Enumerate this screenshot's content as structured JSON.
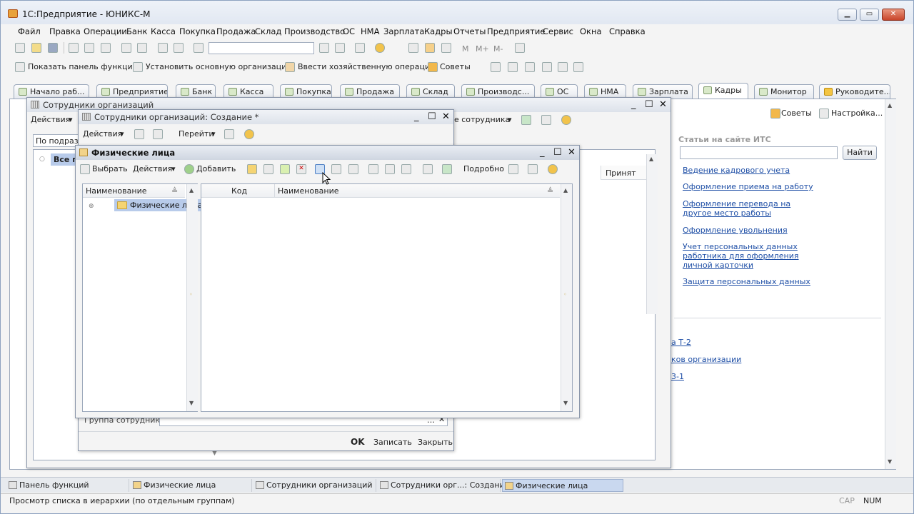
{
  "app": {
    "title": "1С:Предприятие - ЮНИКС-М"
  },
  "menu": [
    "Файл",
    "Правка",
    "Операции",
    "Банк",
    "Касса",
    "Покупка",
    "Продажа",
    "Склад",
    "Производство",
    "ОС",
    "НМА",
    "Зарплата",
    "Кадры",
    "Отчеты",
    "Предприятие",
    "Сервис",
    "Окна",
    "Справка"
  ],
  "toolbar2": {
    "show_panel": "Показать панель функций",
    "set_org": "Установить основную организацию",
    "enter_op": "Ввести хозяйственную операцию",
    "tips": "Советы"
  },
  "tabs": [
    "Начало раб...",
    "Предприятие",
    "Банк",
    "Касса",
    "Покупка",
    "Продажа",
    "Склад",
    "Производс...",
    "ОС",
    "НМА",
    "Зарплата",
    "Кадры",
    "Монитор",
    "Руководите..."
  ],
  "right_panel": {
    "tips": "Советы",
    "settings": "Настройка...",
    "header": "Статьи на сайте ИТС",
    "find_button": "Найти",
    "links": [
      "Ведение кадрового учета",
      "Оформление приема на работу",
      "Оформление перевода на другое место работы",
      "Оформление увольнения",
      "Учет персональных данных работника для оформления личной карточки",
      "Защита персональных данных"
    ],
    "partial_links": [
      "а Т-2",
      "ков организации",
      "3-1"
    ]
  },
  "win_employees": {
    "title": "Сотрудники организаций",
    "actions": "Действия",
    "filter_label": "По подразд",
    "all_label": "Все п",
    "column_hired": "Принят",
    "new_employee": "е сотрудника"
  },
  "win_create": {
    "title": "Сотрудники организаций: Создание *",
    "actions": "Действия",
    "goto": "Перейти",
    "group_label": "Группа сотрудника:",
    "ok": "OK",
    "save": "Записать",
    "close": "Закрыть"
  },
  "win_persons": {
    "title": "Физические лица",
    "select": "Выбрать",
    "actions": "Действия",
    "add": "Добавить",
    "details": "Подробно",
    "tree_col": "Наименование",
    "tree_root": "Физические лица",
    "col_code": "Код",
    "col_name": "Наименование"
  },
  "taskbar": [
    "Панель функций",
    "Физические лица",
    "Сотрудники организаций",
    "Сотрудники орг...: Создание *",
    "Физические лица"
  ],
  "status": {
    "text": "Просмотр списка в иерархии (по отдельным группам)",
    "cap": "CAP",
    "num": "NUM"
  }
}
